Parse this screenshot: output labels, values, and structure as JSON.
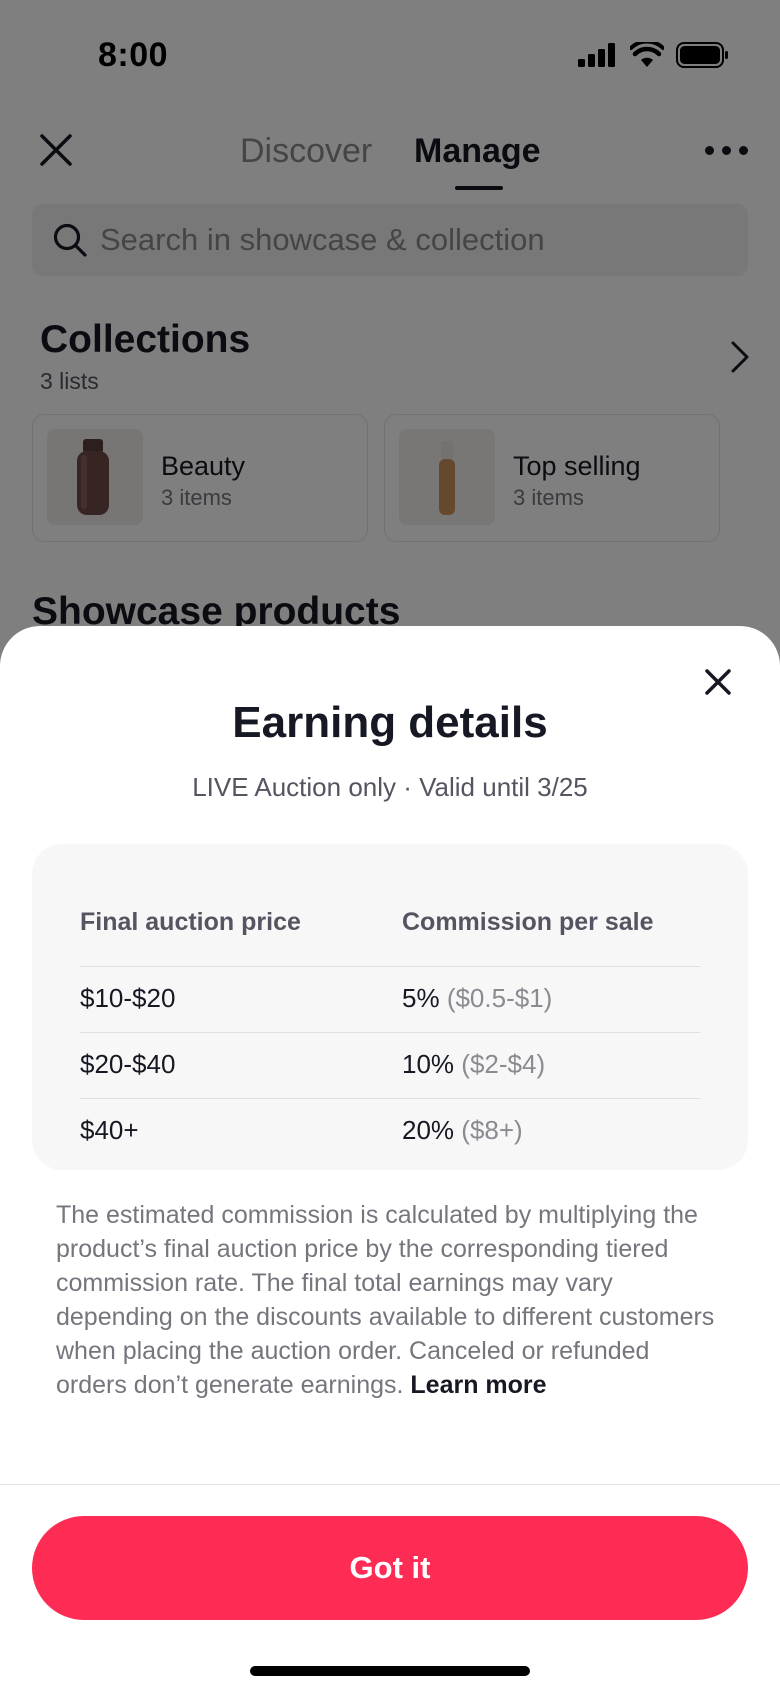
{
  "status_bar": {
    "time": "8:00"
  },
  "header": {
    "tabs": [
      {
        "label": "Discover",
        "active": false
      },
      {
        "label": "Manage",
        "active": true
      }
    ]
  },
  "search": {
    "placeholder": "Search in showcase & collection"
  },
  "collections": {
    "title": "Collections",
    "subtitle": "3 lists",
    "items": [
      {
        "name": "Beauty",
        "count": "3 items"
      },
      {
        "name": "Top selling",
        "count": "3 items"
      }
    ]
  },
  "showcase": {
    "title": "Showcase products"
  },
  "sheet": {
    "title": "Earning details",
    "subtitle": "LIVE Auction only · Valid until 3/25",
    "table": {
      "headers": [
        "Final auction price",
        "Commission per sale"
      ],
      "rows": [
        {
          "price": "$10-$20",
          "rate": "5%",
          "range": "($0.5-$1)"
        },
        {
          "price": "$20-$40",
          "rate": "10%",
          "range": "($2-$4)"
        },
        {
          "price": "$40+",
          "rate": "20%",
          "range": "($8+)"
        }
      ]
    },
    "description": "The estimated commission is calculated by multiplying the product’s final auction price by the corresponding tiered commission rate. The final total earnings may vary depending on the discounts available to different customers when placing the auction order. Canceled or refunded orders don’t generate earnings.",
    "learn_more": "Learn more",
    "button_label": "Got it"
  },
  "colors": {
    "accent": "#fe2c55",
    "text": "#161823",
    "muted": "#75767d"
  }
}
